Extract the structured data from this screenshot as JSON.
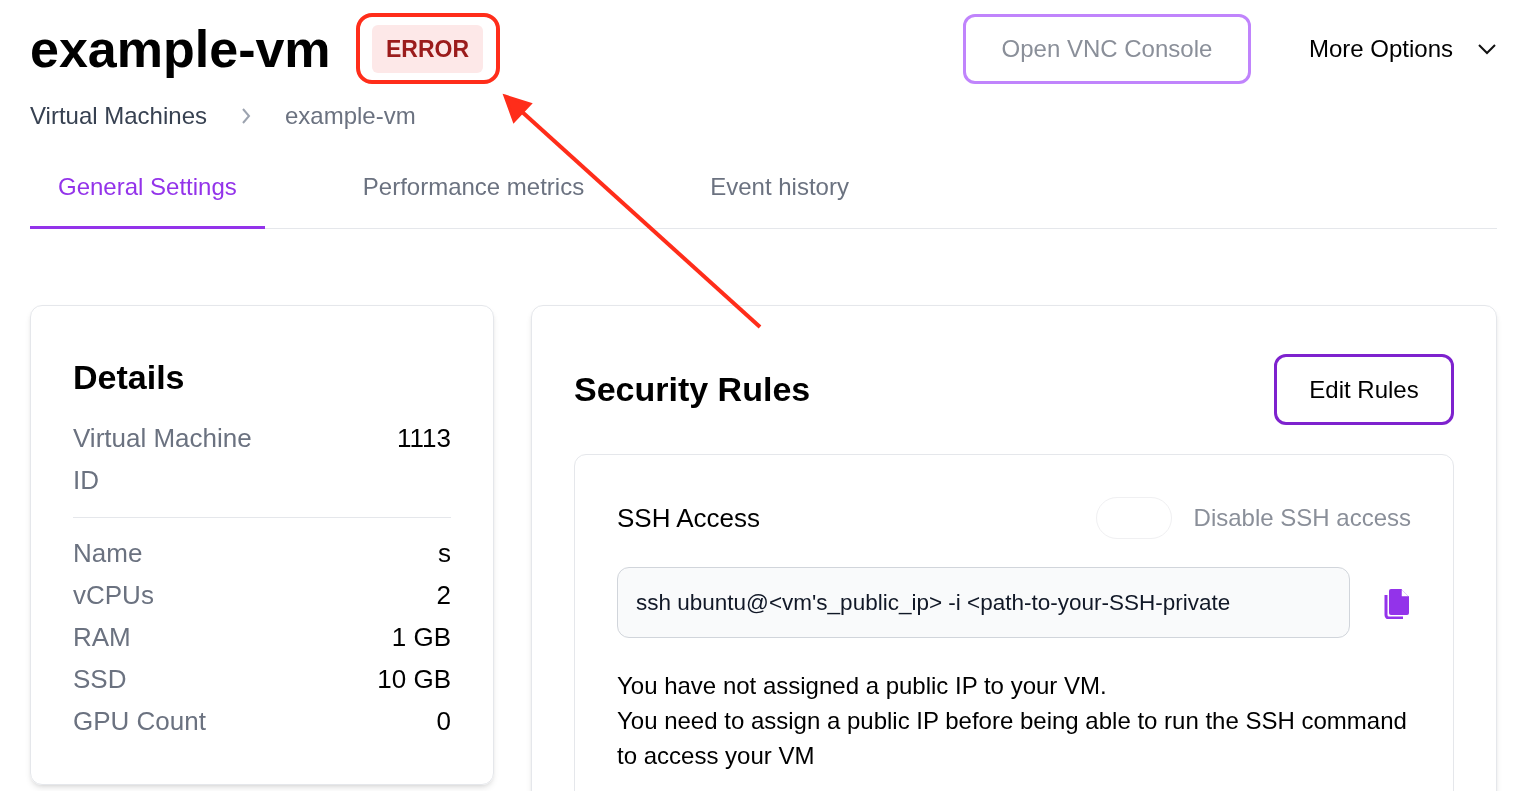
{
  "header": {
    "title": "example-vm",
    "status": "ERROR",
    "vnc_button": {
      "label": "Open VNC Console",
      "disabled": true
    },
    "more_options": "More Options"
  },
  "breadcrumb": [
    "Virtual Machines",
    "example-vm"
  ],
  "tabs": [
    {
      "label": "General Settings",
      "selected": true
    },
    {
      "label": "Performance metrics",
      "selected": false
    },
    {
      "label": "Event history",
      "selected": false
    }
  ],
  "details": {
    "title": "Details",
    "id_row": {
      "label": "Virtual Machine ID",
      "value": "1113"
    },
    "rows": [
      {
        "label": "Name",
        "value": "s"
      },
      {
        "label": "vCPUs",
        "value": "2"
      },
      {
        "label": "RAM",
        "value": "1 GB"
      },
      {
        "label": "SSD",
        "value": "10 GB"
      },
      {
        "label": "GPU Count",
        "value": "0"
      }
    ]
  },
  "security_rules": {
    "title": "Security Rules",
    "edit_button": "Edit Rules",
    "ssh_access": {
      "title": "SSH Access",
      "toggle": {
        "label": "Disable SSH access",
        "on": false
      },
      "command": "ssh ubuntu@<vm's_public_ip> -i <path-to-your-SSH-private",
      "notice": [
        "You have not assigned a public IP to your VM.",
        "You need to assign a public IP before being able to run the SSH command to access your VM"
      ]
    }
  }
}
